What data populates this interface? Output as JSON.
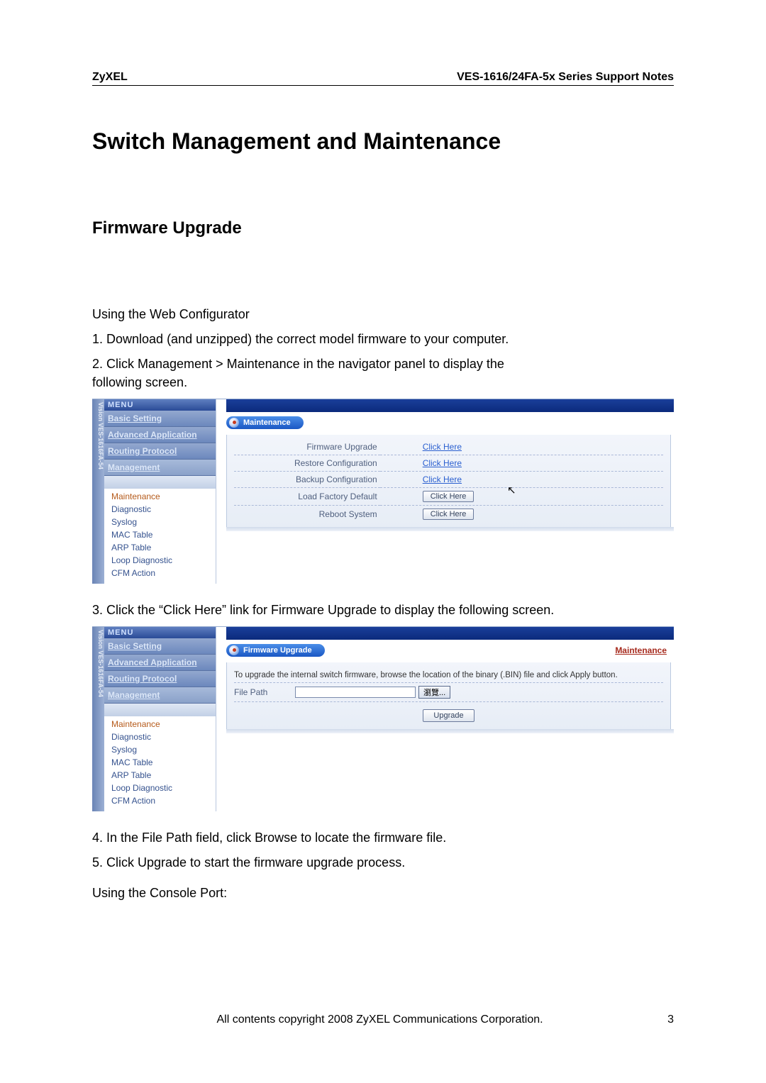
{
  "header": {
    "brand": "ZyXEL",
    "doc_title": "VES-1616/24FA-5x Series Support Notes"
  },
  "h1": "Switch Management and Maintenance",
  "h2": "Firmware Upgrade",
  "intro_lines": {
    "l0": "Using the Web Configurator",
    "l1": "1. Download (and unzipped) the correct model firmware to your computer.",
    "l2": "2. Click Management > Maintenance in the navigator panel to display the",
    "l3": "following screen."
  },
  "step3": "3. Click the “Click Here” link for Firmware Upgrade to display the following screen.",
  "step4": "4. In the File Path field, click Browse to locate the firmware file.",
  "step5": "5. Click Upgrade to start the firmware upgrade process.",
  "console_line": "Using the Console Port:",
  "sidebar": {
    "vtext": "Vision  VES-1616FA-54",
    "menu_label": "MENU",
    "cats": {
      "basic": "Basic Setting",
      "advapp": "Advanced Application",
      "routing": "Routing Protocol",
      "mgmt": "Management"
    },
    "sub": {
      "maintenance": "Maintenance",
      "diagnostic": "Diagnostic",
      "syslog": "Syslog",
      "mactable": "MAC Table",
      "arptable": "ARP Table",
      "loopdiag": "Loop Diagnostic",
      "cfmaction": "CFM Action"
    }
  },
  "maint_panel": {
    "title": "Maintenance",
    "rows": {
      "fw": "Firmware Upgrade",
      "restore": "Restore Configuration",
      "backup": "Backup Configuration",
      "factory": "Load Factory Default",
      "reboot": "Reboot System"
    },
    "link_text": "Click Here",
    "btn_text": "Click Here"
  },
  "fw_panel": {
    "title": "Firmware Upgrade",
    "crumb": "Maintenance",
    "instruction": "To upgrade the internal switch firmware, browse the location of the binary (.BIN) file and click Apply button.",
    "file_path_label": "File Path",
    "browse_label": "瀏覽...",
    "upgrade_label": "Upgrade"
  },
  "footer": {
    "copyright": "All contents copyright 2008 ZyXEL Communications Corporation.",
    "page": "3"
  }
}
